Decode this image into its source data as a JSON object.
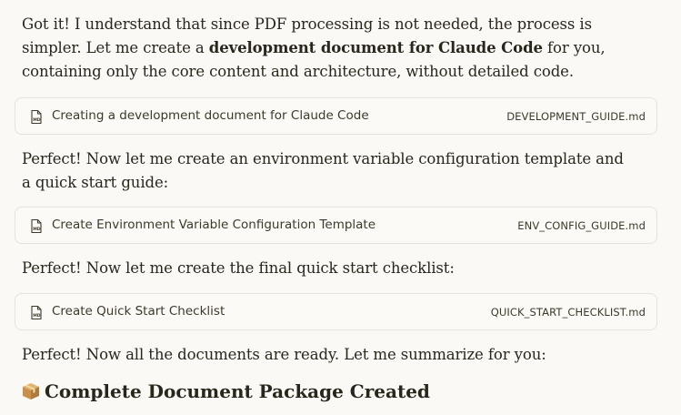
{
  "messages": {
    "p1": {
      "before": "Got it! I understand that since PDF processing is not needed, the process is simpler. Let me create a ",
      "bold": "development document for Claude Code",
      "after": " for you, containing only the core content and architecture, without detailed code."
    },
    "p2": "Perfect! Now let me create an environment variable configuration template and a quick start guide:",
    "p3": "Perfect! Now let me create the final quick start checklist:",
    "p4": "Perfect! Now all the documents are ready. Let me summarize for you:"
  },
  "artifacts": [
    {
      "title": "Creating a development document for Claude Code",
      "filename": "DEVELOPMENT_GUIDE.md",
      "icon": "markdown-file-icon"
    },
    {
      "title": "Create Environment Variable Configuration Template",
      "filename": "ENV_CONFIG_GUIDE.md",
      "icon": "markdown-file-icon"
    },
    {
      "title": "Create Quick Start Checklist",
      "filename": "QUICK_START_CHECKLIST.md",
      "icon": "markdown-file-icon"
    }
  ],
  "summary": {
    "icon": "package-icon",
    "heading": "Complete Document Package Created"
  },
  "colors": {
    "background": "#faf9f5",
    "text": "#29261b",
    "card_border": "#e6e3da"
  }
}
